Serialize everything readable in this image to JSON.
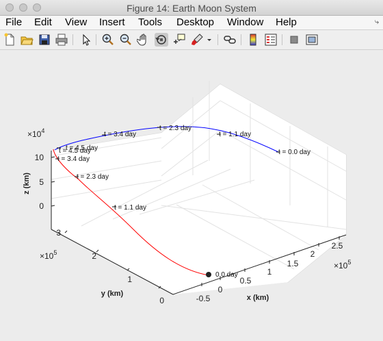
{
  "window": {
    "title": "Figure 14: Earth Moon System",
    "menu": [
      "File",
      "Edit",
      "View",
      "Insert",
      "Tools",
      "Desktop",
      "Window",
      "Help"
    ],
    "menu_overflow": "⤷"
  },
  "toolbar": {
    "buttons": [
      "new-figure",
      "open-file",
      "save-figure",
      "print-figure",
      "edit-plot",
      "zoom-in",
      "zoom-out",
      "pan",
      "rotate-3d",
      "data-cursor",
      "brush",
      "link-plot",
      "insert-colorbar",
      "insert-legend",
      "hide-plot-tools",
      "show-plot-tools"
    ]
  },
  "colors": {
    "moon_trajectory": "#0000ff",
    "spacecraft_trajectory": "#ff0000",
    "axes_bg": "#ffffff"
  },
  "chart_data": {
    "type": "line",
    "title": "",
    "xlabel": "x (km)",
    "ylabel": "y (km)",
    "zlabel": "z (km)",
    "x_ticks": [
      "-0.5",
      "0",
      "0.5",
      "1",
      "1.5",
      "2",
      "2.5"
    ],
    "x_exponent": "×10",
    "x_exponent_power": "5",
    "y_ticks": [
      "0",
      "1",
      "2",
      "3"
    ],
    "y_exponent": "×10",
    "y_exponent_power": "5",
    "z_ticks": [
      "0",
      "5",
      "10"
    ],
    "z_exponent": "×10",
    "z_exponent_power": "4",
    "grid": true,
    "series": [
      {
        "color": "#0000ff",
        "annotations": [
          "t = 0.0 day",
          "t = 1.1 day",
          "t = 2.3 day",
          "t = 3.4 day",
          "t = 4.5 day"
        ]
      },
      {
        "color": "#ff0000",
        "annotations": [
          "0.0 day",
          "t = 1.1 day",
          "t = 2.3 day",
          "t = 3.4 day",
          "t = 4.5 day"
        ]
      }
    ]
  }
}
